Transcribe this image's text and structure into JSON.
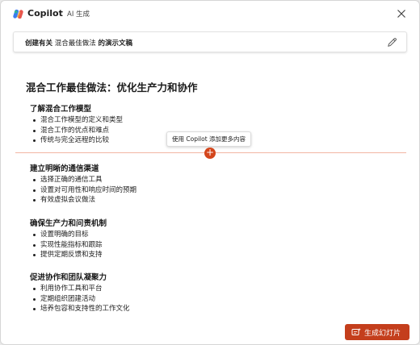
{
  "header": {
    "app_name": "Copilot",
    "badge": "AI 生成",
    "close_icon": "close-icon",
    "logo_icon": "copilot-logo-icon"
  },
  "prompt": {
    "part1": "创建有关",
    "part2": "混合最佳做法",
    "part3": "的演示文稿",
    "edit_icon": "pencil-icon"
  },
  "document": {
    "title": "混合工作最佳做法：优化生产力和协作",
    "sections": [
      {
        "heading": "了解混合工作模型",
        "bullets": [
          "混合工作模型的定义和类型",
          "混合工作的优点和难点",
          "传统与完全远程的比较"
        ]
      },
      {
        "heading": "建立明晰的通信渠道",
        "bullets": [
          "选择正确的通信工具",
          "设置对可用性和响应时间的预期",
          "有效虚拟会议做法"
        ]
      },
      {
        "heading": "确保生产力和问责机制",
        "bullets": [
          "设置明确的目标",
          "实现性能指标和跟踪",
          "提供定期反馈和支持"
        ]
      },
      {
        "heading": "促进协作和团队凝聚力",
        "bullets": [
          "利用协作工具和平台",
          "定期组织团建活动",
          "培养包容和支持性的工作文化"
        ]
      }
    ]
  },
  "insert": {
    "tooltip": "使用 Copilot 添加更多内容",
    "button_symbol": "+"
  },
  "footer": {
    "generate_label": "生成幻灯片",
    "generate_icon": "slides-icon"
  },
  "colors": {
    "accent": "#c43e1c",
    "insert_line": "#f2b5a3"
  }
}
